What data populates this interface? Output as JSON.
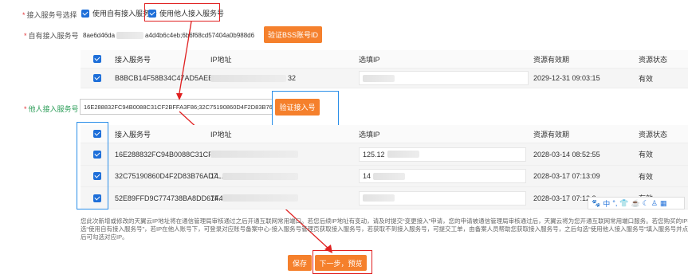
{
  "form": {
    "selection_label": "接入服务号选择",
    "opt_own": "使用自有接入服务号",
    "opt_other": "使用他人接入服务号",
    "own_label": "自有接入服务号",
    "own_value_prefix": "8ae6d46da",
    "own_value_suffix": "a4d4b6c4eb;6b6f68cd57404a0b988d6",
    "verify_bss_button": "验证BSS账号ID",
    "other_label": "他人接入服务号",
    "other_value": "16E288832FC94B0088C31CF2BFFA3F86;32C75190860D4F2D83B76AD",
    "verify_access_button": "验证接入号"
  },
  "table1": {
    "headers": [
      "接入服务号",
      "IP地址",
      "选填IP",
      "资源有效期",
      "资源状态"
    ],
    "rows": [
      {
        "service_no": "B8BCB14F58B34C47AD5AEBA6...",
        "ip_tail": "32",
        "expiry": "2029-12-31 09:03:15",
        "status": "有效"
      }
    ]
  },
  "table2": {
    "headers": [
      "接入服务号",
      "IP地址",
      "选填IP",
      "资源有效期",
      "资源状态"
    ],
    "rows": [
      {
        "service_no": "16E288832FC94B0088C31CF28...",
        "ip_prefix": "",
        "optional_ip": "125.12",
        "expiry": "2028-03-14 08:52:55",
        "status": "有效"
      },
      {
        "service_no": "32C75190860D4F2D83B76AD7...",
        "ip_prefix": "14.",
        "optional_ip": "14",
        "expiry": "2028-03-17 07:13:09",
        "status": "有效"
      },
      {
        "service_no": "52E89FFD9C774738BA8DD67F4...",
        "ip_prefix": "14.",
        "optional_ip": "",
        "expiry": "2028-03-17 07:12:2",
        "status": "有效"
      }
    ]
  },
  "notice": {
    "line1": "您此次新增或修改的天翼云IP地址将在通信管理局审核通过之后开通互联网常用端口。若您后续IP地址有变动，请及时提交“变更接入”申请，您的申请被通信管理局审核通过后，天翼云将为您开通互联网常用端口服务。若您购买的IP在本账号下，请",
    "line2": "选“使用自有接入服务号”，若IP在他人账号下，可登录对应账号备案中心-接入服务号管理页获取接入服务号，若获取不到接入服务号，可提交工单，由备案人员帮助您获取接入服务号，之后勾选“使用他人接入服务号”填入服务号并点击验",
    "line3": "后可勾选对应IP。"
  },
  "footer": {
    "save_button": "保存",
    "next_button": "下一步，预览"
  },
  "ime_tray": {
    "items": [
      "paw-icon",
      "中",
      "°,",
      "shirt-icon",
      "cup-icon",
      "moon-icon",
      "person-icon",
      "grid-icon"
    ],
    "zh": "中",
    "punct": "°,"
  },
  "colors": {
    "accent_orange": "#f5802c",
    "checkbox_blue": "#1e6fd9",
    "annotation_red": "#e02020",
    "annotation_blue": "#2a8ee8"
  }
}
